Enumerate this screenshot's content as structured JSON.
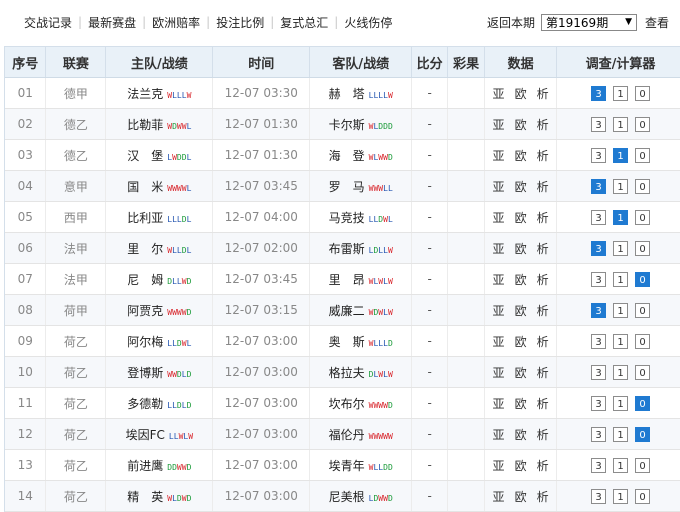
{
  "nav": {
    "items": [
      "交战记录",
      "最新赛盘",
      "欧洲赔率",
      "投注比例",
      "复式总汇",
      "火线伤停"
    ],
    "period_label": "返回本期",
    "period_value": "第19169期",
    "view_label": "查看"
  },
  "headers": [
    "序号",
    "联赛",
    "主队/战绩",
    "时间",
    "客队/战绩",
    "比分",
    "彩果",
    "数据",
    "调查/计算器"
  ],
  "data_links": [
    "亚",
    "欧",
    "析"
  ],
  "calc_labels": [
    "3",
    "1",
    "0"
  ],
  "colors": {
    "accent": "#1f7ad1",
    "win": "#d8262c",
    "draw": "#1c9b3a",
    "loss": "#2354b0",
    "header_bg": "#e9f1f8"
  },
  "rows": [
    {
      "no": "01",
      "league": "德甲",
      "home": "法兰克",
      "home_form": "WLLLW",
      "time": "12-07 03:30",
      "away": "赫　塔",
      "away_form": "LLLLW",
      "score": "-",
      "result": "",
      "active": [
        0
      ]
    },
    {
      "no": "02",
      "league": "德乙",
      "home": "比勒菲",
      "home_form": "WDWWL",
      "time": "12-07 01:30",
      "away": "卡尔斯",
      "away_form": "WLDDD",
      "score": "-",
      "result": "",
      "active": []
    },
    {
      "no": "03",
      "league": "德乙",
      "home": "汉　堡",
      "home_form": "LWDDL",
      "time": "12-07 01:30",
      "away": "海　登",
      "away_form": "WLWWD",
      "score": "-",
      "result": "",
      "active": [
        1
      ]
    },
    {
      "no": "04",
      "league": "意甲",
      "home": "国　米",
      "home_form": "WWWWL",
      "time": "12-07 03:45",
      "away": "罗　马",
      "away_form": "WWWLL",
      "score": "-",
      "result": "",
      "active": [
        0
      ]
    },
    {
      "no": "05",
      "league": "西甲",
      "home": "比利亚",
      "home_form": "LLLDL",
      "time": "12-07 04:00",
      "away": "马竞技",
      "away_form": "LLDWL",
      "score": "-",
      "result": "",
      "active": [
        1
      ]
    },
    {
      "no": "06",
      "league": "法甲",
      "home": "里　尔",
      "home_form": "WLLDL",
      "time": "12-07 02:00",
      "away": "布雷斯",
      "away_form": "LDLLW",
      "score": "-",
      "result": "",
      "active": [
        0
      ]
    },
    {
      "no": "07",
      "league": "法甲",
      "home": "尼　姆",
      "home_form": "DLLWD",
      "time": "12-07 03:45",
      "away": "里　昂",
      "away_form": "WLWLW",
      "score": "-",
      "result": "",
      "active": [
        2
      ]
    },
    {
      "no": "08",
      "league": "荷甲",
      "home": "阿贾克",
      "home_form": "WWWWD",
      "time": "12-07 03:15",
      "away": "威廉二",
      "away_form": "WDWLW",
      "score": "-",
      "result": "",
      "active": [
        0
      ]
    },
    {
      "no": "09",
      "league": "荷乙",
      "home": "阿尔梅",
      "home_form": "LLDWL",
      "time": "12-07 03:00",
      "away": "奥　斯",
      "away_form": "WLLLD",
      "score": "-",
      "result": "",
      "active": []
    },
    {
      "no": "10",
      "league": "荷乙",
      "home": "登博斯",
      "home_form": "WWDLD",
      "time": "12-07 03:00",
      "away": "格拉夫",
      "away_form": "DLWLW",
      "score": "-",
      "result": "",
      "active": []
    },
    {
      "no": "11",
      "league": "荷乙",
      "home": "多德勒",
      "home_form": "LLDLD",
      "time": "12-07 03:00",
      "away": "坎布尔",
      "away_form": "WWWWD",
      "score": "-",
      "result": "",
      "active": [
        2
      ]
    },
    {
      "no": "12",
      "league": "荷乙",
      "home": "埃因FC",
      "home_form": "LLWLW",
      "time": "12-07 03:00",
      "away": "福伦丹",
      "away_form": "WWWWW",
      "score": "-",
      "result": "",
      "active": [
        2
      ]
    },
    {
      "no": "13",
      "league": "荷乙",
      "home": "前进鹰",
      "home_form": "DDWWD",
      "time": "12-07 03:00",
      "away": "埃青年",
      "away_form": "WLLDD",
      "score": "-",
      "result": "",
      "active": []
    },
    {
      "no": "14",
      "league": "荷乙",
      "home": "精　英",
      "home_form": "WLDWD",
      "time": "12-07 03:00",
      "away": "尼美根",
      "away_form": "LDWWD",
      "score": "-",
      "result": "",
      "active": []
    }
  ]
}
